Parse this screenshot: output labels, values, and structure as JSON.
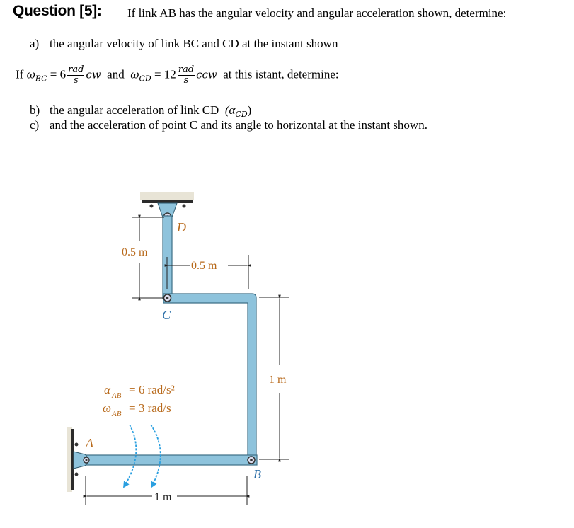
{
  "question": {
    "heading": "Question [5]:",
    "prompt": "If link AB has the angular velocity and angular acceleration shown, determine:"
  },
  "parts": {
    "a": {
      "label": "a)",
      "text": "the angular velocity of link BC and CD at the instant shown"
    },
    "b": {
      "label": "b)",
      "text": "the angular acceleration of link CD",
      "symbol": "(α",
      "symbol_sub": "CD",
      "symbol_close": ")"
    },
    "c": {
      "label": "c)",
      "text": "and the acceleration of point C and its angle to horizontal at the instant shown."
    }
  },
  "given": {
    "prefix": "If",
    "omega_bc_symbol": "ω",
    "omega_bc_sub": "BC",
    "omega_bc_value": "= 6",
    "unit_num": "rad",
    "unit_den": "s",
    "omega_bc_dir": "cw",
    "conj": "and",
    "omega_cd_symbol": "ω",
    "omega_cd_sub": "CD",
    "omega_cd_value": "= 12",
    "omega_cd_dir": "ccw",
    "suffix": "at this istant, determine:"
  },
  "diagram": {
    "points": {
      "A": "A",
      "B": "B",
      "C": "C",
      "D": "D"
    },
    "dimensions": {
      "cd_height": "0.5 m",
      "c_offset": "0.5 m",
      "bc_height": "1 m",
      "ab_length": "1 m"
    },
    "loads": {
      "alpha_symbol": "α",
      "alpha_sub": "AB",
      "alpha_value": "= 6 rad/s²",
      "omega_symbol": "ω",
      "omega_sub": "AB",
      "omega_value": "= 3 rad/s"
    },
    "colors": {
      "link_fill": "#8ec3dc",
      "link_edge": "#3d6f86",
      "label_color": "#b86a1c",
      "arrow_color": "#2a9fe0",
      "ground": "#e8e4d6"
    }
  }
}
